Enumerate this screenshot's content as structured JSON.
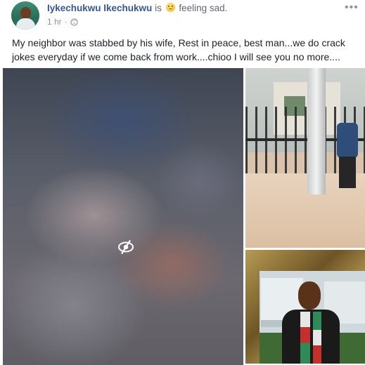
{
  "post": {
    "author": "Iykechukwu Ikechukwu",
    "is_word": "is",
    "feeling_text": "feeling sad.",
    "timestamp": "1 hr",
    "privacy_icon": "globe-icon",
    "more_label": "•••",
    "text": "My neighbor was stabbed by his wife, Rest in peace, best man...we do crack jokes everyday if we come back from work....chioo I will see you no more....",
    "hidden_media_icon": "eye-slash-icon"
  },
  "colors": {
    "name_link": "#365899",
    "meta_text": "#90949c",
    "body_text": "#1d2129"
  }
}
